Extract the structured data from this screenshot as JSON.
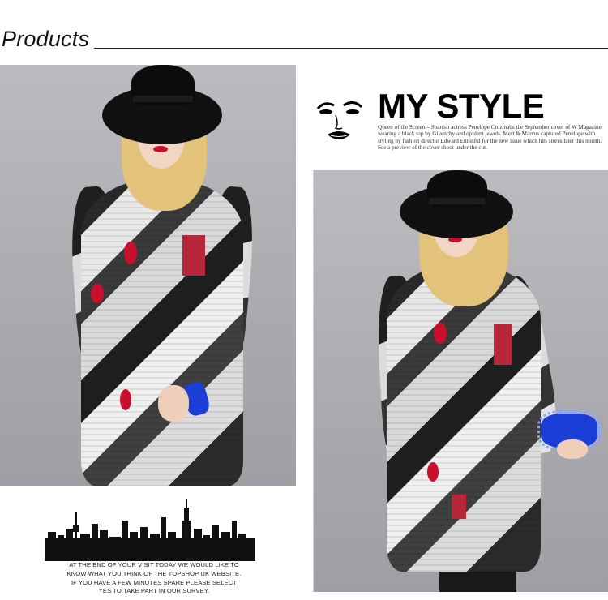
{
  "header": {
    "title": "Products"
  },
  "style_feature": {
    "title": "MY STYLE",
    "body": "Queen of the Screen – Spanish actress Penelope Cruz nabs the September cover of W Magazine wearing a black top by Givenchy and opulent jewels. Mert & Marcus captured Penelope with styling by fashion director Edward Enninful for the new issue which hits stores later this month. See a preview of the cover shoot under the cut.",
    "face_art_icon": "lips-face-icon"
  },
  "footer": {
    "skyline_icon": "city-skyline-icon",
    "survey_text": "AT THE END OF YOUR VISIT TODAY WE WOULD LIKE TO KNOW WHAT YOU THINK OF THE TOPSHOP UK WEBSITE. IF YOU HAVE A FEW MINUTES SPARE PLEASE SELECT YES TO TAKE PART IN OUR SURVEY."
  },
  "colors": {
    "accent": "#c8102e",
    "clutch": "#1b3fd6",
    "background": "#ffffff"
  }
}
